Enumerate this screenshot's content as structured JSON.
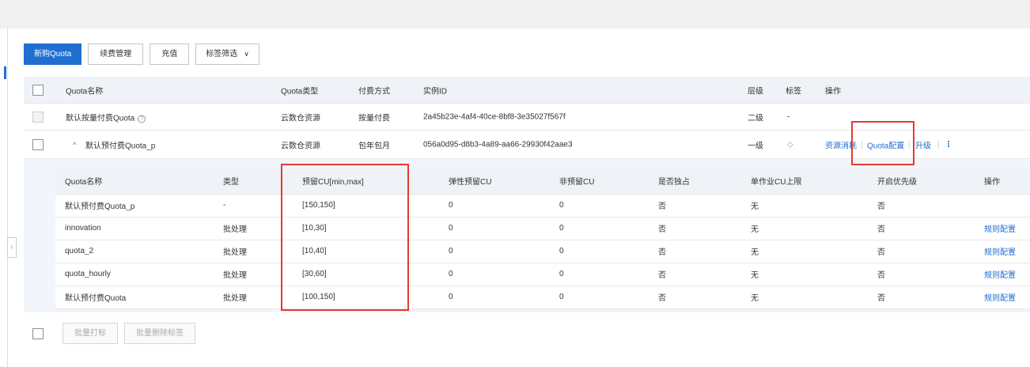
{
  "toolbar": {
    "buy": "新购Quota",
    "renew": "续费管理",
    "recharge": "充值",
    "tag_filter": "标签筛选"
  },
  "main_table": {
    "headers": {
      "name": "Quota名称",
      "type": "Quota类型",
      "pay": "付费方式",
      "instance": "实例ID",
      "level": "层级",
      "tag": "标签",
      "ops": "操作"
    },
    "rows": [
      {
        "name": "默认按量付费Quota",
        "type": "云数仓资源",
        "pay": "按量付费",
        "instance": "2a45b23e-4af4-40ce-8bf8-3e35027f567f",
        "level": "二级",
        "tag": "-"
      },
      {
        "expand": "^",
        "name": "默认预付费Quota_p",
        "type": "云数仓资源",
        "pay": "包年包月",
        "instance": "056a0d95-d8b3-4a89-aa66-29930f42aae3",
        "level": "一级",
        "ops": {
          "consume": "资源消耗",
          "quota_config": "Quota配置",
          "upgrade": "升级",
          "more": "⋮"
        }
      }
    ]
  },
  "sub_table": {
    "headers": [
      "Quota名称",
      "类型",
      "预留CU[min,max]",
      "弹性预留CU",
      "非预留CU",
      "是否独占",
      "单作业CU上限",
      "开启优先级",
      "操作"
    ],
    "rows": [
      [
        "默认预付费Quota_p",
        "-",
        "[150,150]",
        "0",
        "0",
        "否",
        "无",
        "否",
        ""
      ],
      [
        "innovation",
        "批处理",
        "[10,30]",
        "0",
        "0",
        "否",
        "无",
        "否",
        "规则配置"
      ],
      [
        "quota_2",
        "批处理",
        "[10,40]",
        "0",
        "0",
        "否",
        "无",
        "否",
        "规则配置"
      ],
      [
        "quota_hourly",
        "批处理",
        "[30,60]",
        "0",
        "0",
        "否",
        "无",
        "否",
        "规则配置"
      ],
      [
        "默认预付费Quota",
        "批处理",
        "[100,150]",
        "0",
        "0",
        "否",
        "无",
        "否",
        "规则配置"
      ]
    ]
  },
  "bottom": {
    "batch_tag": "批量打标",
    "batch_delete_tag": "批量删除标签"
  },
  "icons": {
    "info": "?",
    "collapse": "‹",
    "chevron": "∨",
    "tag": "◇"
  },
  "colors": {
    "primary": "#1f6fd0",
    "highlight": "#e53935"
  }
}
